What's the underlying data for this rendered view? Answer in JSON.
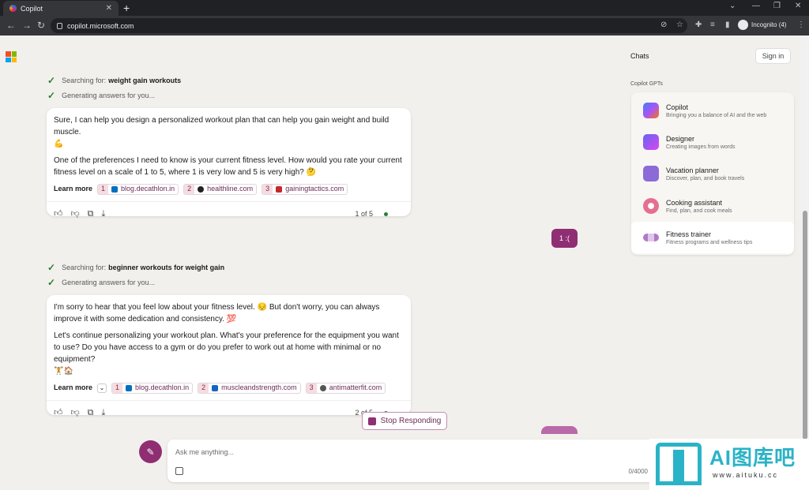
{
  "browser": {
    "tab_title": "Copilot",
    "tab_close": "✕",
    "new_tab": "+",
    "url": "copilot.microsoft.com",
    "incognito": "Incognito (4)",
    "win_min": "⌄",
    "win_min2": "—",
    "win_max": "❐",
    "win_close": "✕"
  },
  "conversation": {
    "block1": {
      "search_prefix": "Searching for:",
      "search_query": "weight gain workouts",
      "generating": "Generating answers for you...",
      "para1": "Sure, I can help you design a personalized workout plan that can help you gain weight and build muscle.",
      "emoji1": "💪",
      "para2": "One of the preferences I need to know is your current fitness level. How would you rate your current fitness level on a scale of 1 to 5, where 1 is very low and 5 is very high?",
      "emoji2": "🤔",
      "learn_more": "Learn more",
      "sources": [
        {
          "num": "1",
          "domain": "blog.decathlon.in",
          "color": "#0070c0"
        },
        {
          "num": "2",
          "domain": "healthline.com",
          "color": "#222222"
        },
        {
          "num": "3",
          "domain": "gainingtactics.com",
          "color": "#c62828"
        }
      ],
      "pager": "1 of 5"
    },
    "user_msg": "1 :(",
    "block2": {
      "search_prefix": "Searching for:",
      "search_query": "beginner workouts for weight gain",
      "generating": "Generating answers for you...",
      "para1": "I'm sorry to hear that you feel low about your fitness level. 😔 But don't worry, you can always improve it with some dedication and consistency.",
      "emoji1": "💯",
      "para2": "Let's continue personalizing your workout plan. What's your preference for the equipment you want to use? Do you have access to a gym or do you prefer to work out at home with minimal or no equipment?",
      "emoji2": "🏋️🏠",
      "learn_more": "Learn more",
      "sources": [
        {
          "num": "1",
          "domain": "blog.decathlon.in",
          "color": "#0070c0"
        },
        {
          "num": "2",
          "domain": "muscleandstrength.com",
          "color": "#1565c0"
        },
        {
          "num": "3",
          "domain": "antimatterfit.com",
          "color": "#555555"
        }
      ],
      "pager": "2 of 5"
    },
    "stop_label": "Stop Responding"
  },
  "input": {
    "placeholder": "Ask me anything...",
    "count": "0/4000"
  },
  "sidebar": {
    "chats_title": "Chats",
    "sign_in": "Sign in",
    "gpts_title": "Copilot GPTs",
    "gpts": [
      {
        "name": "Copilot",
        "desc": "Bringing you a balance of AI and the web",
        "color": "#5b6ee1"
      },
      {
        "name": "Designer",
        "desc": "Creating images from words",
        "color": "#a259e6"
      },
      {
        "name": "Vacation planner",
        "desc": "Discover, plan, and book travels",
        "color": "#8c6ad8"
      },
      {
        "name": "Cooking assistant",
        "desc": "Find, plan, and cook meals",
        "color": "#e56f8f"
      },
      {
        "name": "Fitness trainer",
        "desc": "Fitness programs and wellness tips",
        "color": "#b07ac8"
      }
    ]
  },
  "watermark": {
    "text": "AI图库吧",
    "url": "www.aituku.cc"
  }
}
